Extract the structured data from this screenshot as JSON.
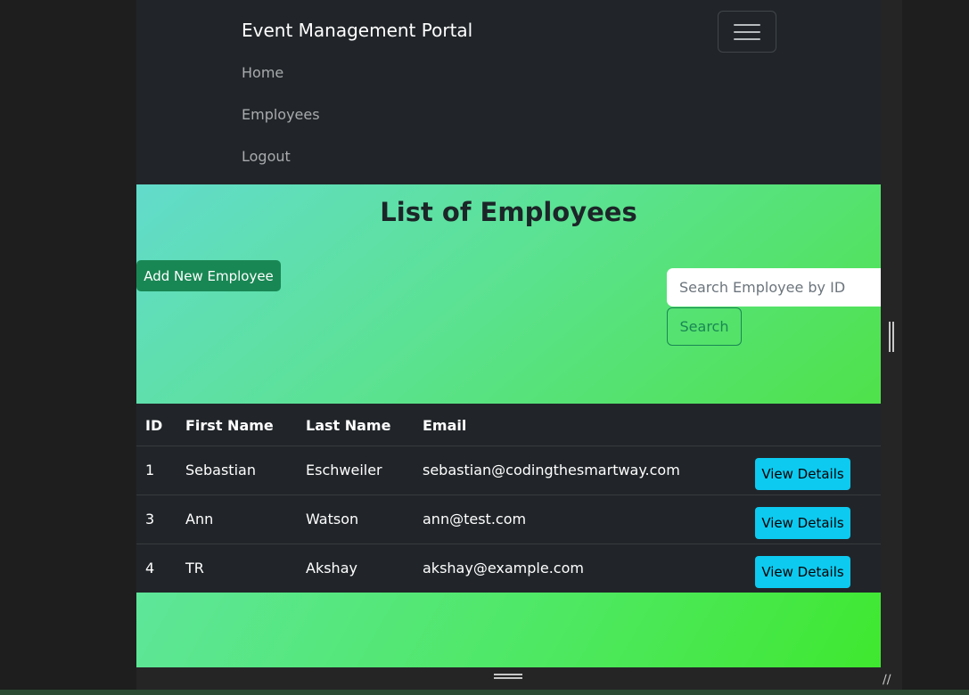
{
  "navbar": {
    "brand": "Event Management Portal",
    "links": [
      "Home",
      "Employees",
      "Logout"
    ]
  },
  "hero": {
    "title": "List of Employees",
    "add_button": "Add New Employee",
    "search_placeholder": "Search Employee by ID",
    "search_button": "Search"
  },
  "table": {
    "headers": [
      "ID",
      "First Name",
      "Last Name",
      "Email"
    ],
    "action_label": "View Details",
    "rows": [
      {
        "id": "1",
        "first": "Sebastian",
        "last": "Eschweiler",
        "email": "sebastian@codingthesmartway.com"
      },
      {
        "id": "3",
        "first": "Ann",
        "last": "Watson",
        "email": "ann@test.com"
      },
      {
        "id": "4",
        "first": "TR",
        "last": "Akshay",
        "email": "akshay@example.com"
      }
    ]
  },
  "icons": {
    "menu": "hamburger-icon",
    "resize_vertical": "vertical-resize-grip-icon",
    "resize_horizontal": "horizontal-resize-grip-icon",
    "resize_corner": "corner-resize-grip-icon"
  },
  "colors": {
    "navbar_bg": "#212529",
    "success": "#198754",
    "info": "#0dcaf0",
    "gradient_start": "#62dbcc",
    "gradient_end": "#4fe24a"
  }
}
